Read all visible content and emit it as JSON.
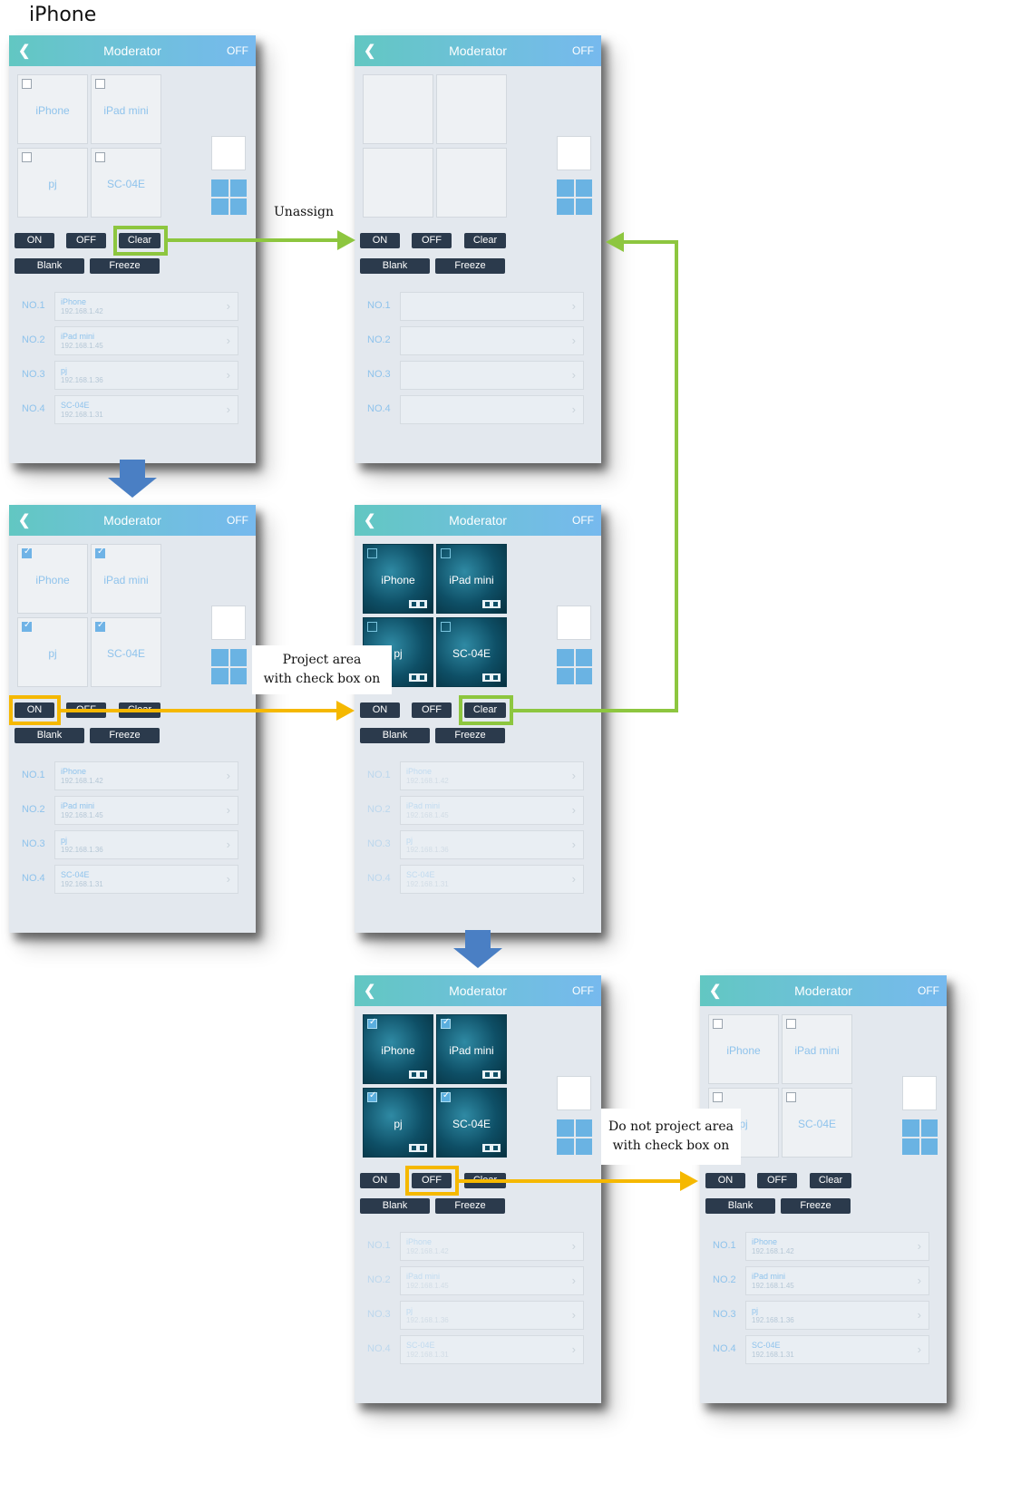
{
  "page_label": "iPhone",
  "colors": {
    "green": "#8dc63f",
    "yellow": "#f5b800",
    "blue_arrow": "#4a7fc4",
    "button": "#2b3a4c"
  },
  "screens": [
    {
      "id": "s1",
      "title": "Moderator",
      "back": "❮",
      "state": "OFF",
      "tiles": [
        {
          "label": "iPhone"
        },
        {
          "label": "iPad mini"
        },
        {
          "label": "pj"
        },
        {
          "label": "SC-04E"
        }
      ],
      "buttons": {
        "on": "ON",
        "off": "OFF",
        "clear": "Clear",
        "blank": "Blank",
        "freeze": "Freeze"
      },
      "rows": [
        {
          "no": "NO.1",
          "name": "iPhone",
          "ip": "192.168.1.42"
        },
        {
          "no": "NO.2",
          "name": "iPad mini",
          "ip": "192.168.1.45"
        },
        {
          "no": "NO.3",
          "name": "pj",
          "ip": "192.168.1.36"
        },
        {
          "no": "NO.4",
          "name": "SC-04E",
          "ip": "192.168.1.31"
        }
      ]
    },
    {
      "id": "s2",
      "title": "Moderator",
      "back": "❮",
      "state": "OFF",
      "buttons": {
        "on": "ON",
        "off": "OFF",
        "clear": "Clear",
        "blank": "Blank",
        "freeze": "Freeze"
      },
      "rows": [
        {
          "no": "NO.1"
        },
        {
          "no": "NO.2"
        },
        {
          "no": "NO.3"
        },
        {
          "no": "NO.4"
        }
      ]
    },
    {
      "id": "s3",
      "title": "Moderator",
      "back": "❮",
      "state": "OFF",
      "tiles": [
        {
          "label": "iPhone"
        },
        {
          "label": "iPad mini"
        },
        {
          "label": "pj"
        },
        {
          "label": "SC-04E"
        }
      ],
      "buttons": {
        "on": "ON",
        "off": "OFF",
        "clear": "Clear",
        "blank": "Blank",
        "freeze": "Freeze"
      },
      "rows": [
        {
          "no": "NO.1",
          "name": "iPhone",
          "ip": "192.168.1.42"
        },
        {
          "no": "NO.2",
          "name": "iPad mini",
          "ip": "192.168.1.45"
        },
        {
          "no": "NO.3",
          "name": "pj",
          "ip": "192.168.1.36"
        },
        {
          "no": "NO.4",
          "name": "SC-04E",
          "ip": "192.168.1.31"
        }
      ]
    },
    {
      "id": "s4",
      "title": "Moderator",
      "back": "❮",
      "state": "OFF",
      "tiles": [
        {
          "label": "iPhone"
        },
        {
          "label": "iPad mini"
        },
        {
          "label": "pj"
        },
        {
          "label": "SC-04E"
        }
      ],
      "buttons": {
        "on": "ON",
        "off": "OFF",
        "clear": "Clear",
        "blank": "Blank",
        "freeze": "Freeze"
      },
      "rows": [
        {
          "no": "NO.1",
          "name": "iPhone",
          "ip": "192.168.1.42"
        },
        {
          "no": "NO.2",
          "name": "iPad mini",
          "ip": "192.168.1.45"
        },
        {
          "no": "NO.3",
          "name": "pj",
          "ip": "192.168.1.36"
        },
        {
          "no": "NO.4",
          "name": "SC-04E",
          "ip": "192.168.1.31"
        }
      ]
    },
    {
      "id": "s5",
      "title": "Moderator",
      "back": "❮",
      "state": "OFF",
      "tiles": [
        {
          "label": "iPhone"
        },
        {
          "label": "iPad mini"
        },
        {
          "label": "pj"
        },
        {
          "label": "SC-04E"
        }
      ],
      "buttons": {
        "on": "ON",
        "off": "OFF",
        "clear": "Clear",
        "blank": "Blank",
        "freeze": "Freeze"
      },
      "rows": [
        {
          "no": "NO.1",
          "name": "iPhone",
          "ip": "192.168.1.42"
        },
        {
          "no": "NO.2",
          "name": "iPad mini",
          "ip": "192.168.1.45"
        },
        {
          "no": "NO.3",
          "name": "pj",
          "ip": "192.168.1.36"
        },
        {
          "no": "NO.4",
          "name": "SC-04E",
          "ip": "192.168.1.31"
        }
      ]
    },
    {
      "id": "s6",
      "title": "Moderator",
      "back": "❮",
      "state": "OFF",
      "tiles": [
        {
          "label": "iPhone"
        },
        {
          "label": "iPad mini"
        },
        {
          "label": "pj"
        },
        {
          "label": "SC-04E"
        }
      ],
      "buttons": {
        "on": "ON",
        "off": "OFF",
        "clear": "Clear",
        "blank": "Blank",
        "freeze": "Freeze"
      },
      "rows": [
        {
          "no": "NO.1",
          "name": "iPhone",
          "ip": "192.168.1.42"
        },
        {
          "no": "NO.2",
          "name": "iPad mini",
          "ip": "192.168.1.45"
        },
        {
          "no": "NO.3",
          "name": "pj",
          "ip": "192.168.1.36"
        },
        {
          "no": "NO.4",
          "name": "SC-04E",
          "ip": "192.168.1.31"
        }
      ]
    }
  ],
  "annotations": {
    "unassign": "Unassign",
    "project_line1": "Project area",
    "project_line2": "with check box on",
    "noproject_line1": "Do not project area",
    "noproject_line2": "with check box on"
  }
}
